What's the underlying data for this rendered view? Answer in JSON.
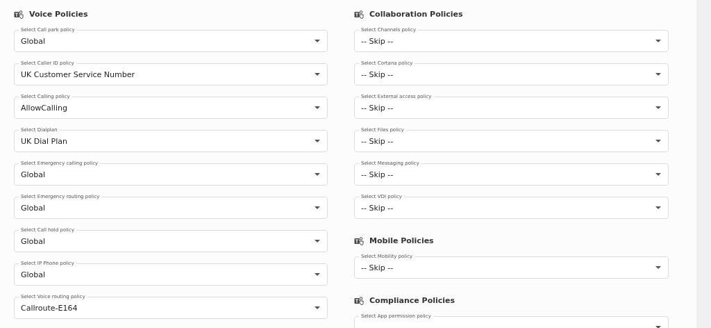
{
  "columns": [
    {
      "sections": [
        {
          "title": "Voice Policies",
          "fields": [
            {
              "label": "Select Call park policy",
              "value": "Global"
            },
            {
              "label": "Select Caller ID policy",
              "value": "UK Customer Service Number"
            },
            {
              "label": "Select Calling policy",
              "value": "AllowCalling"
            },
            {
              "label": "Select Dialplan",
              "value": "UK Dial Plan"
            },
            {
              "label": "Select Emergency calling policy",
              "value": "Global"
            },
            {
              "label": "Select Emergency routing policy",
              "value": "Global"
            },
            {
              "label": "Select Call hold policy",
              "value": "Global"
            },
            {
              "label": "Select IP Phone policy",
              "value": "Global"
            },
            {
              "label": "Select Voice routing policy",
              "value": "Callroute-E164"
            }
          ]
        }
      ]
    },
    {
      "sections": [
        {
          "title": "Collaboration Policies",
          "fields": [
            {
              "label": "Select Channels policy",
              "value": "-- Skip --"
            },
            {
              "label": "Select Cortana policy",
              "value": "-- Skip --"
            },
            {
              "label": "Select External access policy",
              "value": "-- Skip --"
            },
            {
              "label": "Select Files policy",
              "value": "-- Skip --"
            },
            {
              "label": "Select Messaging policy",
              "value": "-- Skip --"
            },
            {
              "label": "Select VDI policy",
              "value": "-- Skip --"
            }
          ]
        },
        {
          "title": "Mobile Policies",
          "fields": [
            {
              "label": "Select Mobility policy",
              "value": "-- Skip --"
            }
          ]
        },
        {
          "title": "Compliance Policies",
          "fields": [
            {
              "label": "Select App permission policy"
            }
          ]
        }
      ]
    }
  ]
}
